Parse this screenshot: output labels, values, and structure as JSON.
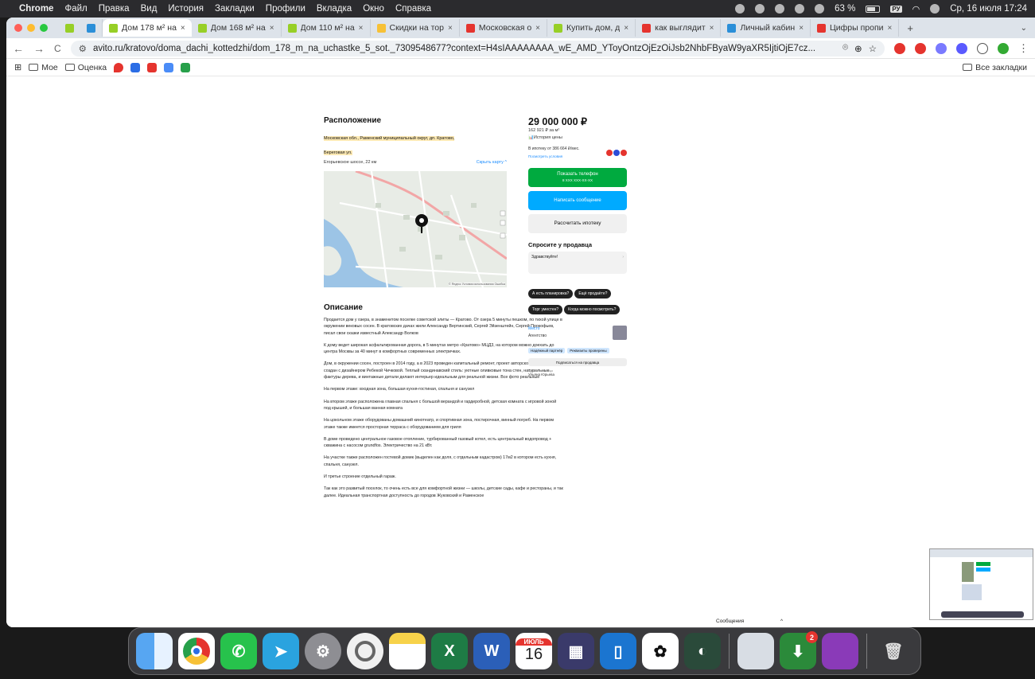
{
  "menubar": {
    "apple": "",
    "app": "Chrome",
    "items": [
      "Файл",
      "Правка",
      "Вид",
      "История",
      "Закладки",
      "Профили",
      "Вкладка",
      "Окно",
      "Справка"
    ],
    "battery": "63 %",
    "input_lang": "РУ",
    "datetime": "Ср, 16 июля 17:24"
  },
  "tabs": [
    {
      "title": "Дом 178 м² на",
      "active": true,
      "color": "#97cf26"
    },
    {
      "title": "Дом 168 м² на",
      "color": "#97cf26"
    },
    {
      "title": "Дом 110 м² на",
      "color": "#97cf26"
    },
    {
      "title": "Скидки на тор",
      "color": "#f7c136"
    },
    {
      "title": "Московская о",
      "color": "#e5342e"
    },
    {
      "title": "Купить дом, д",
      "color": "#97cf26"
    },
    {
      "title": "как выглядит",
      "color": "#e5342e"
    },
    {
      "title": "Личный кабин",
      "color": "#2b8fd8"
    },
    {
      "title": "Цифры пропи",
      "color": "#e5342e"
    }
  ],
  "tab_close": "×",
  "tab_new": "+",
  "address": {
    "url": "avito.ru/kratovo/doma_dachi_kottedzhi/dom_178_m_na_uchastke_5_sot._7309548677?context=H4sIAAAAAAAA_wE_AMD_YToyOntzOjEzOiJsb2NhbFByaW9yaXR5IjtiOjE7cz...",
    "back": "←",
    "forward": "→",
    "reload": "C"
  },
  "bookmarks": {
    "items": [
      "Мое",
      "Оценка"
    ],
    "all": "Все закладки"
  },
  "listing": {
    "location_title": "Расположение",
    "address": "Московская обл., Раменский муниципальный округ, дп. Кратово, Береговая ул.",
    "highway": "Егорьевское шоссе, 22 км",
    "hide_map": "Скрыть карту ^",
    "map_attrib": "© Яндекс  Условия использования  Ошибка",
    "desc_title": "Описание",
    "desc": [
      "Продается дом у озера, в знаменитом поселке советской элиты — Кратово. От озера 5 минуты пешком, по тихой улице в окружении вековых сосен. В кратовских дачах жили Александр Вертинский, Сергей Эйзенштейн, Сергей Прокофьев, писал свои сказки известный Александр Волков",
      "К дому ведет широкая асфальтированная дорога, в 5 минутах метро «Кратово» МЦД3, на котором можно доехать до центра Москвы за 40 минут в комфортных современных электричках.",
      "Дом, в окружении сосен, построен в 2014 году, а в 2023 проведен капитальный ремонт, проект авторского интерьера создан с дизайнером Ребекой Чичковой. Теплый скандинавский стиль: уютные оливковые тона стен, натуральные фактуры дерева, и винтажные детали делают интерьер идеальным для реальной жизни. Все фото реальные",
      "На первом этаже: входная зона, большая кухня-гостиная, спальня и санузел",
      "На втором этаже расположена главная спальня с большой верандой и гардеробной, детская комната с игровой зоной под крышей, и большая ванная комната",
      "На цокольном этаже оборудованы домашний кинотеатр, и спортивная зона, постирочная, винный погреб. На первом этаже также имеется просторная терраса с оборудованием для гриля",
      "В доме проведено центральное газовое отопление, турбированный газовый котел, есть центральный водопровод + скважина с насосом grundfos. Электричество на 21 кВт.",
      "На участке также расположен гостевой домик (выделен как доля, с отдельным кадастром) 17м2 в котором есть кухня, спальня, санузел.",
      "И третье строение отдельный гараж.",
      "Так как это развитый поселок, то очень есть все для комфортной жизни — школы, детские сады, кафе и рестораны, и так далее. Идеальная транспортная доступность до городов Жуковский и Раменское"
    ],
    "price": "29 000 000 ₽",
    "price_per_m": "162 921 ₽ за м²",
    "price_history": "История цены",
    "mortgage": "В ипотеку от 386 664 ₽/мес.",
    "mortgage_link": "Посмотреть условия",
    "show_phone": "Показать телефон",
    "show_phone_sub": "8 XXX XXX-XX-XX",
    "write": "Написать сообщение",
    "calc": "Рассчитать ипотеку",
    "ask_title": "Спросите у продавца",
    "ask_placeholder": "Здравствуйте!",
    "chips": [
      "А есть планировка?",
      "Ещё продаёте?",
      "Торг уместен?",
      "Когда можно посмотреть?"
    ],
    "seller_name": "Место",
    "seller_type": "Агентство",
    "seller_tags": [
      "Надёжный партнёр",
      "Реквизиты проверены"
    ],
    "subscribe": "Подписаться на продавца",
    "contact_label": "Контактное лицо",
    "contact_name": "Ульяна Юрьева"
  },
  "messages_panel": {
    "label": "Сообщения",
    "chevron": "^"
  },
  "dock": {
    "calendar_month": "ИЮЛЬ",
    "calendar_day": "16",
    "badge": "2"
  },
  "colors": {
    "green": "#00aa3f",
    "blue": "#00aaff",
    "chip": "#222222",
    "addr_hl": "#fde9b3"
  }
}
